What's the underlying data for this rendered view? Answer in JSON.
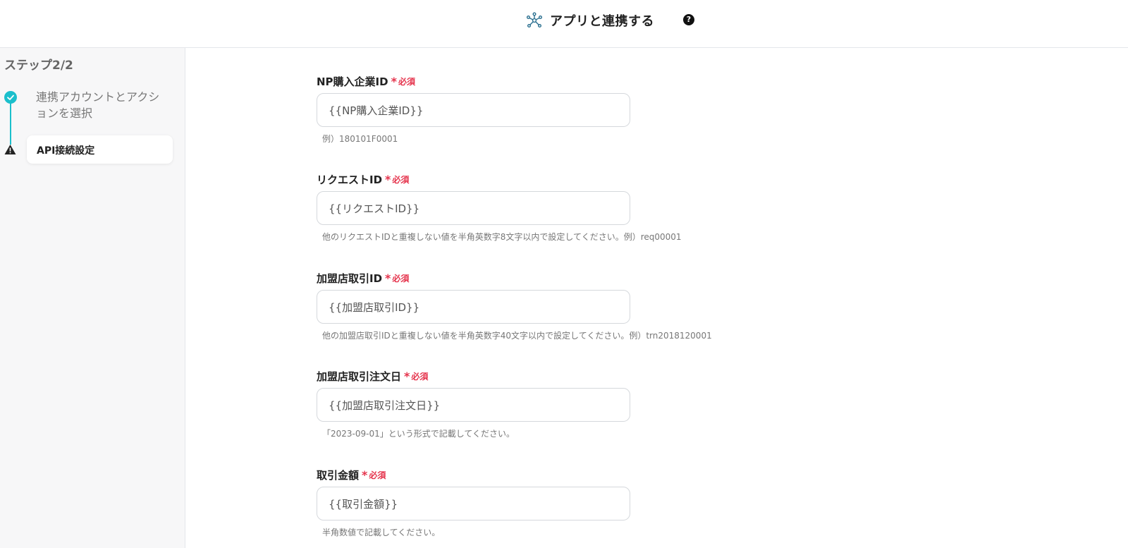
{
  "header": {
    "title": "アプリと連携する",
    "icon": "app-connect-icon",
    "help_icon": "help-icon",
    "help_glyph": "?"
  },
  "sidebar": {
    "step_heading": "ステップ2/2",
    "steps": [
      {
        "label": "連携アカウントとアクションを選択",
        "status": "done",
        "icon": "check-icon"
      },
      {
        "label": "API接続設定",
        "status": "warning",
        "icon": "warning-icon"
      }
    ]
  },
  "form": {
    "required_mark": "*",
    "required_text": "必須",
    "fields": [
      {
        "label": "NP購入企業ID",
        "value": "{{NP購入企業ID}}",
        "hint": "例）180101F0001"
      },
      {
        "label": "リクエストID",
        "value": "{{リクエストID}}",
        "hint": "他のリクエストIDと重複しない値を半角英数字8文字以内で設定してください。例）req00001"
      },
      {
        "label": "加盟店取引ID",
        "value": "{{加盟店取引ID}}",
        "hint": "他の加盟店取引IDと重複しない値を半角英数字40文字以内で設定してください。例）trn2018120001"
      },
      {
        "label": "加盟店取引注文日",
        "value": "{{加盟店取引注文日}}",
        "hint": "「2023-09-01」という形式で記載してください。"
      },
      {
        "label": "取引金額",
        "value": "{{取引金額}}",
        "hint": "半角数値で記載してください。"
      }
    ]
  },
  "colors": {
    "accent": "#1bbfcc",
    "required": "#e5334c"
  }
}
